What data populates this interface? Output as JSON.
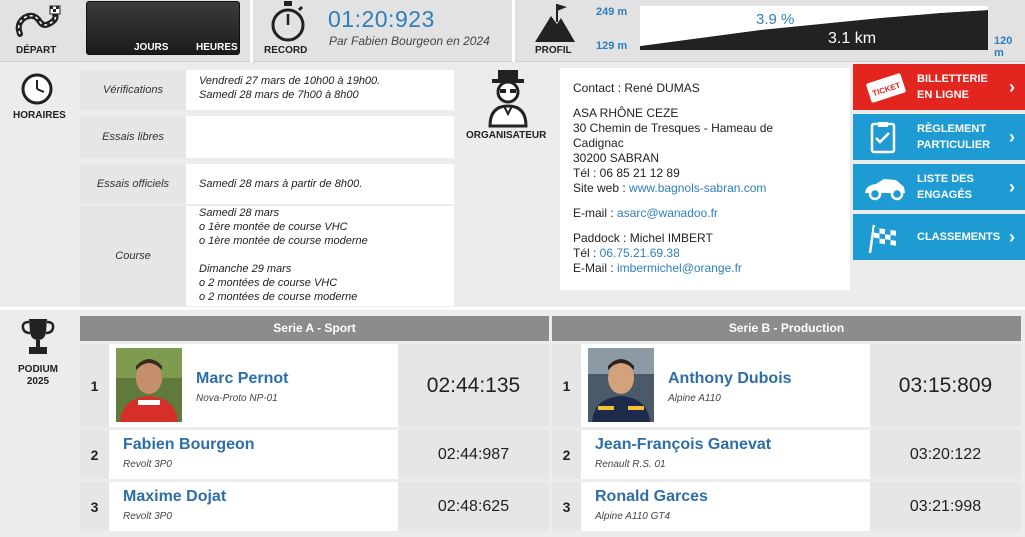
{
  "topbar": {
    "depart_label": "DÉPART",
    "countdown_days_label": "JOURS",
    "countdown_hours_label": "HEURES",
    "record_label": "RECORD",
    "record_time": "01:20:923",
    "record_by": "Par Fabien Bourgeon en 2024",
    "profil_label": "PROFIL",
    "alt_top": "249 m",
    "alt_bottom": "129 m",
    "alt_end": "120 m",
    "gradient": "3.9 %",
    "distance": "3.1 km"
  },
  "horaires": {
    "label": "HORAIRES",
    "rows": [
      {
        "key": "Vérifications",
        "lines": [
          "Vendredi 27 mars de 10h00 à 19h00.",
          "Samedi 28 mars de 7h00 à 8h00"
        ]
      },
      {
        "key": "Essais libres",
        "lines": []
      },
      {
        "key": "Essais officiels",
        "lines": [
          "Samedi 28 mars à partir de 8h00."
        ]
      },
      {
        "key": "Course",
        "lines": [
          "Samedi 28 mars",
          "o 1ère montée de course VHC",
          "o 1ère montée de course moderne",
          "",
          "Dimanche 29 mars",
          "o 2 montées de course VHC",
          "o 2 montées de course moderne"
        ]
      }
    ]
  },
  "organisateur": {
    "label": "ORGANISATEUR",
    "contact": "Contact : René DUMAS",
    "org_name": "ASA RHÔNE CEZE",
    "address1": "30 Chemin de Tresques - Hameau de",
    "address2": "Cadignac",
    "address3": "30200 SABRAN",
    "tel": "Tél : 06 85 21 12 89",
    "site_prefix": "Site web : ",
    "site": "www.bagnols-sabran.com",
    "email_prefix": "E-mail : ",
    "email": "asarc@wanadoo.fr",
    "paddock": "Paddock : Michel IMBERT",
    "paddock_tel_prefix": "Tél : ",
    "paddock_tel": "06.75.21.69.38",
    "paddock_email_prefix": "E-Mail : ",
    "paddock_email": "imbermichel@orange.fr"
  },
  "sidebar": {
    "buttons": [
      {
        "line1": "BILLETTERIE",
        "line2": "EN LIGNE",
        "color": "#e3251f",
        "icon": "ticket-icon"
      },
      {
        "line1": "RÈGLEMENT",
        "line2": "PARTICULIER",
        "color": "#1f9bd3",
        "icon": "clipboard-icon"
      },
      {
        "line1": "LISTE DES",
        "line2": "ENGAGÉS",
        "color": "#1f9bd3",
        "icon": "race-car-icon"
      },
      {
        "line1": "CLASSEMENTS",
        "line2": "",
        "color": "#1f9bd3",
        "icon": "checkered-flag-icon"
      }
    ]
  },
  "podium": {
    "label_line1": "PODIUM",
    "label_line2": "2025",
    "series": [
      {
        "title": "Serie A - Sport",
        "results": [
          {
            "pos": "1",
            "name": "Marc Pernot",
            "car": "Nova-Proto NP-01",
            "time": "02:44:135"
          },
          {
            "pos": "2",
            "name": "Fabien Bourgeon",
            "car": "Revolt 3P0",
            "time": "02:44:987"
          },
          {
            "pos": "3",
            "name": "Maxime Dojat",
            "car": "Revolt 3P0",
            "time": "02:48:625"
          }
        ]
      },
      {
        "title": "Serie B - Production",
        "results": [
          {
            "pos": "1",
            "name": "Anthony Dubois",
            "car": "Alpine A110",
            "time": "03:15:809"
          },
          {
            "pos": "2",
            "name": "Jean-François Ganevat",
            "car": "Renault R.S. 01",
            "time": "03:20:122"
          },
          {
            "pos": "3",
            "name": "Ronald Garces",
            "car": "Alpine A110 GT4",
            "time": "03:21:998"
          }
        ]
      }
    ]
  }
}
